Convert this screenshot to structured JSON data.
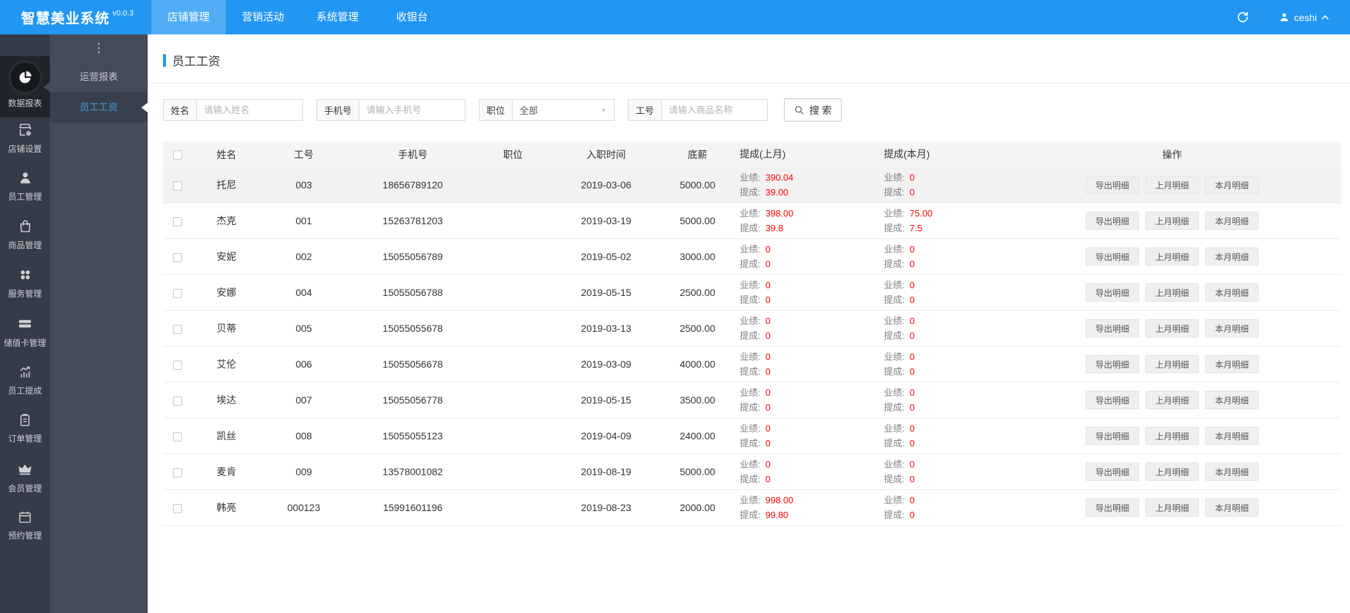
{
  "colors": {
    "header_blue": "#2196f3",
    "header_active_tab": "rgba(255,255,255,0.22)",
    "sidebar_bg": "#353b47",
    "submenu_bg": "#454b57",
    "active_link_blue": "#3f9ae0",
    "value_red": "#ff0000"
  },
  "header": {
    "brand": "智慧美业系统",
    "version": "v0.0.3",
    "nav": [
      {
        "label": "店铺管理",
        "active": true
      },
      {
        "label": "营销活动",
        "active": false
      },
      {
        "label": "系统管理",
        "active": false
      },
      {
        "label": "收银台",
        "active": false
      }
    ],
    "icons": [
      "refresh-icon",
      "user-icon",
      "caret-up-icon"
    ],
    "user": {
      "name": "ceshi"
    }
  },
  "sidebar": {
    "items": [
      {
        "label": "数据报表",
        "icon": "pie-chart-icon",
        "active": true
      },
      {
        "label": "店铺设置",
        "icon": "storefront-icon",
        "active": false
      },
      {
        "label": "员工管理",
        "icon": "person-icon",
        "active": false
      },
      {
        "label": "商品管理",
        "icon": "shopping-bag-icon",
        "active": false
      },
      {
        "label": "服务管理",
        "icon": "grid-dots-icon",
        "active": false
      },
      {
        "label": "储值卡管理",
        "icon": "credit-card-icon",
        "active": false
      },
      {
        "label": "员工提成",
        "icon": "stats-chart-icon",
        "active": false
      },
      {
        "label": "订单管理",
        "icon": "clipboard-icon",
        "active": false
      },
      {
        "label": "会员管理",
        "icon": "crown-icon",
        "active": false
      },
      {
        "label": "预约管理",
        "icon": "calendar-icon",
        "active": false
      }
    ]
  },
  "submenu": {
    "collapse_icon": "vertical-ellipsis-icon",
    "items": [
      {
        "label": "运营报表",
        "active": false
      },
      {
        "label": "员工工资",
        "active": true
      }
    ]
  },
  "page": {
    "title": "员工工资"
  },
  "filters": {
    "name": {
      "label": "姓名",
      "placeholder": "请输入姓名",
      "value": ""
    },
    "phone": {
      "label": "手机号",
      "placeholder": "请输入手机号",
      "value": ""
    },
    "position": {
      "label": "职位",
      "selected": "全部"
    },
    "job_no": {
      "label": "工号",
      "placeholder": "请输入商品名称",
      "value": ""
    },
    "search_button": "搜 索"
  },
  "table": {
    "headers": [
      "姓名",
      "工号",
      "手机号",
      "职位",
      "入职时间",
      "底薪",
      "提成(上月)",
      "提成(本月)",
      "操作"
    ],
    "perf_label": "业绩:",
    "comm_label": "提成:",
    "actions": [
      "导出明细",
      "上月明细",
      "本月明细"
    ],
    "rows": [
      {
        "name": "托尼",
        "job_no": "003",
        "phone": "18656789120",
        "position": "",
        "hire_date": "2019-03-06",
        "base_salary": "5000.00",
        "last_month": {
          "perf": "390.04",
          "comm": "39.00"
        },
        "this_month": {
          "perf": "0",
          "comm": "0"
        }
      },
      {
        "name": "杰克",
        "job_no": "001",
        "phone": "15263781203",
        "position": "",
        "hire_date": "2019-03-19",
        "base_salary": "5000.00",
        "last_month": {
          "perf": "398.00",
          "comm": "39.8"
        },
        "this_month": {
          "perf": "75.00",
          "comm": "7.5"
        }
      },
      {
        "name": "安妮",
        "job_no": "002",
        "phone": "15055056789",
        "position": "",
        "hire_date": "2019-05-02",
        "base_salary": "3000.00",
        "last_month": {
          "perf": "0",
          "comm": "0"
        },
        "this_month": {
          "perf": "0",
          "comm": "0"
        }
      },
      {
        "name": "安娜",
        "job_no": "004",
        "phone": "15055056788",
        "position": "",
        "hire_date": "2019-05-15",
        "base_salary": "2500.00",
        "last_month": {
          "perf": "0",
          "comm": "0"
        },
        "this_month": {
          "perf": "0",
          "comm": "0"
        }
      },
      {
        "name": "贝蒂",
        "job_no": "005",
        "phone": "15055055678",
        "position": "",
        "hire_date": "2019-03-13",
        "base_salary": "2500.00",
        "last_month": {
          "perf": "0",
          "comm": "0"
        },
        "this_month": {
          "perf": "0",
          "comm": "0"
        }
      },
      {
        "name": "艾伦",
        "job_no": "006",
        "phone": "15055056678",
        "position": "",
        "hire_date": "2019-03-09",
        "base_salary": "4000.00",
        "last_month": {
          "perf": "0",
          "comm": "0"
        },
        "this_month": {
          "perf": "0",
          "comm": "0"
        }
      },
      {
        "name": "埃达",
        "job_no": "007",
        "phone": "15055056778",
        "position": "",
        "hire_date": "2019-05-15",
        "base_salary": "3500.00",
        "last_month": {
          "perf": "0",
          "comm": "0"
        },
        "this_month": {
          "perf": "0",
          "comm": "0"
        }
      },
      {
        "name": "凯丝",
        "job_no": "008",
        "phone": "15055055123",
        "position": "",
        "hire_date": "2019-04-09",
        "base_salary": "2400.00",
        "last_month": {
          "perf": "0",
          "comm": "0"
        },
        "this_month": {
          "perf": "0",
          "comm": "0"
        }
      },
      {
        "name": "麦肯",
        "job_no": "009",
        "phone": "13578001082",
        "position": "",
        "hire_date": "2019-08-19",
        "base_salary": "5000.00",
        "last_month": {
          "perf": "0",
          "comm": "0"
        },
        "this_month": {
          "perf": "0",
          "comm": "0"
        }
      },
      {
        "name": "韩亮",
        "job_no": "000123",
        "phone": "15991601196",
        "position": "",
        "hire_date": "2019-08-23",
        "base_salary": "2000.00",
        "last_month": {
          "perf": "998.00",
          "comm": "99.80"
        },
        "this_month": {
          "perf": "0",
          "comm": "0"
        }
      }
    ]
  }
}
